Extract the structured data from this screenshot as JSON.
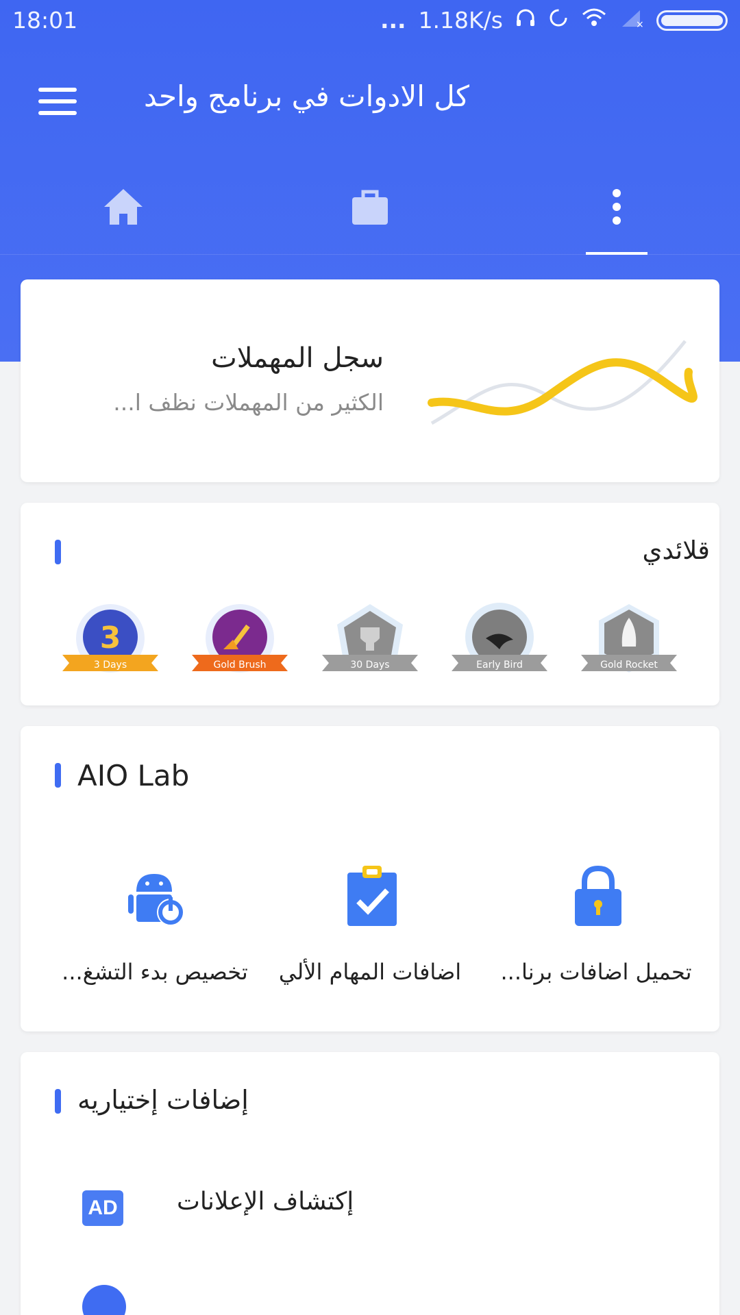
{
  "status_bar": {
    "time": "18:01",
    "dots": "...",
    "speed": "1.18K/s",
    "icons": [
      "headset-icon",
      "sync-icon",
      "wifi-icon",
      "signal-icon",
      "battery-icon"
    ]
  },
  "app_bar": {
    "title": "كل الادوات في برنامج واحد",
    "menu_icon": "menu-icon"
  },
  "tabs": [
    {
      "icon": "home-icon",
      "selected": false
    },
    {
      "icon": "briefcase-icon",
      "selected": false
    },
    {
      "icon": "more-vertical-icon",
      "selected": true
    }
  ],
  "junk_card": {
    "title": "سجل المهملات",
    "subtitle": "الكثير من المهملات نظف ا...",
    "icon": "wave-graph-icon"
  },
  "badges_card": {
    "title": "قلائدي",
    "badges": [
      {
        "label": "3 Days",
        "icon": "laurel-badge-icon",
        "unlocked": true
      },
      {
        "label": "Gold Brush",
        "icon": "brush-badge-icon",
        "unlocked": true
      },
      {
        "label": "30 Days",
        "icon": "trophy-badge-icon",
        "unlocked": false
      },
      {
        "label": "Early Bird",
        "icon": "bird-badge-icon",
        "unlocked": false
      },
      {
        "label": "Gold Rocket",
        "icon": "rocket-badge-icon",
        "unlocked": false
      }
    ]
  },
  "lab_card": {
    "title": "AIO Lab",
    "items": [
      {
        "label": "تخصيص بدء التشغ...",
        "icon": "android-power-icon"
      },
      {
        "label": "اضافات المهام الألي",
        "icon": "clipboard-check-icon"
      },
      {
        "label": "تحميل اضافات برنا...",
        "icon": "lock-icon"
      }
    ]
  },
  "optional_card": {
    "title": "إضافات إختياريه",
    "items": [
      {
        "label": "إكتشاف الإعلانات",
        "icon": "ad-icon",
        "icon_text": "AD"
      }
    ]
  },
  "colors": {
    "primary_blue": "#3f66f2",
    "accent_yellow": "#f5c518",
    "badge_orange": "#f39c21"
  }
}
